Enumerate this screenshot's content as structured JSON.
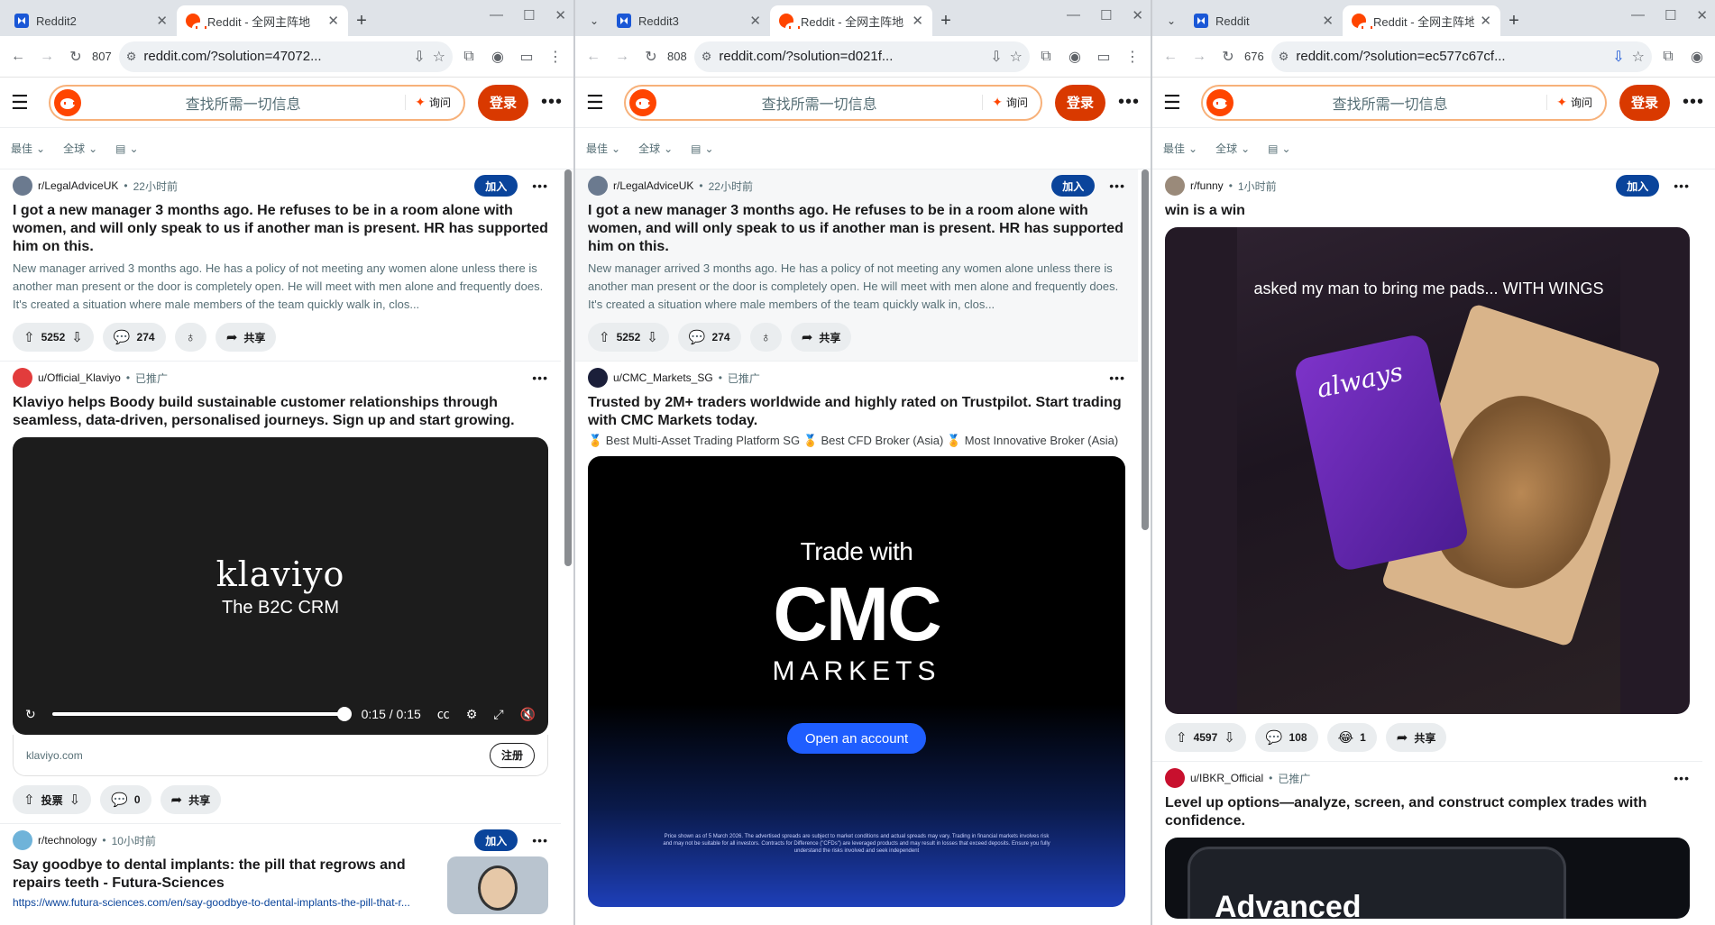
{
  "windows": [
    {
      "tabs": [
        {
          "title": "Reddit2"
        },
        {
          "title": "Reddit - 全网主阵地"
        }
      ],
      "count": "807",
      "url": "reddit.com/?solution=47072...",
      "search_placeholder": "查找所需一切信息",
      "ask_label": "询问",
      "login_label": "登录",
      "sort": {
        "best": "最佳",
        "region": "全球"
      },
      "posts": [
        {
          "subreddit": "r/LegalAdviceUK",
          "time": "22小时前",
          "join": "加入",
          "title": "I got a new manager 3 months ago. He refuses to be in a room alone with women, and will only speak to us if another man is present. HR has supported him on this.",
          "body": "New manager arrived 3 months ago. He has a policy of not meeting any women alone unless there is another man present or the door is completely open. He will meet with men alone and frequently does. It's created a situation where male members of the team quickly walk in, clos...",
          "votes": "5252",
          "comments": "274",
          "share": "共享"
        },
        {
          "author": "u/Official_Klaviyo",
          "promoted": "已推广",
          "title": "Klaviyo helps Boody build sustainable customer relationships through seamless, data-driven, personalised journeys. Sign up and start growing.",
          "ad_brand": "klaviyo",
          "ad_tagline": "The B2C CRM",
          "video_time": "0:15 / 0:15",
          "domain": "klaviyo.com",
          "signup": "注册",
          "vote_label": "投票",
          "comments": "0",
          "share": "共享"
        },
        {
          "subreddit": "r/technology",
          "time": "10小时前",
          "join": "加入",
          "title": "Say goodbye to dental implants: the pill that regrows and repairs teeth - Futura-Sciences",
          "link": "https://www.futura-sciences.com/en/say-goodbye-to-dental-implants-the-pill-that-r..."
        }
      ]
    },
    {
      "tabs": [
        {
          "title": "Reddit3"
        },
        {
          "title": "Reddit - 全网主阵地"
        }
      ],
      "count": "808",
      "url": "reddit.com/?solution=d021f...",
      "search_placeholder": "查找所需一切信息",
      "ask_label": "询问",
      "login_label": "登录",
      "sort": {
        "best": "最佳",
        "region": "全球"
      },
      "posts": [
        {
          "subreddit": "r/LegalAdviceUK",
          "time": "22小时前",
          "join": "加入",
          "title": "I got a new manager 3 months ago. He refuses to be in a room alone with women, and will only speak to us if another man is present. HR has supported him on this.",
          "body": "New manager arrived 3 months ago. He has a policy of not meeting any women alone unless there is another man present or the door is completely open. He will meet with men alone and frequently does. It's created a situation where male members of the team quickly walk in, clos...",
          "votes": "5252",
          "comments": "274",
          "share": "共享"
        },
        {
          "author": "u/CMC_Markets_SG",
          "promoted": "已推广",
          "title": "Trusted by 2M+ traders worldwide and highly rated on Trustpilot. Start trading with CMC Markets today.",
          "subtext": "🏅 Best Multi-Asset Trading Platform SG 🏅 Best CFD Broker (Asia) 🏅 Most Innovative Broker (Asia)",
          "ad_top": "Trade with",
          "ad_logo": "CMC",
          "ad_markets": "MARKETS",
          "ad_cta": "Open an account",
          "ad_fine": "Price shown as of 5 March 2026. The advertised spreads are subject to market conditions and actual spreads may vary. Trading in financial markets involves risk and may not be suitable for all investors. Contracts for Difference (\"CFDs\") are leveraged products and may result in losses that exceed deposits. Ensure you fully understand the risks involved and seek independent"
        }
      ]
    },
    {
      "tabs": [
        {
          "title": "Reddit"
        },
        {
          "title": "Reddit - 全网主阵地"
        }
      ],
      "count": "676",
      "url": "reddit.com/?solution=ec577c67cf...",
      "search_placeholder": "查找所需一切信息",
      "ask_label": "询问",
      "login_label": "登录",
      "sort": {
        "best": "最佳",
        "region": "全球"
      },
      "posts": [
        {
          "subreddit": "r/funny",
          "time": "1小时前",
          "join": "加入",
          "title": "win is a win",
          "caption": "asked my man to bring me pads... WITH WINGS",
          "pad_brand": "always",
          "votes": "4597",
          "comments": "108",
          "awards": "1",
          "share": "共享"
        },
        {
          "author": "u/IBKR_Official",
          "promoted": "已推广",
          "title": "Level up options—analyze, screen, and construct complex trades with confidence.",
          "ad_text": "Advanced"
        }
      ]
    }
  ],
  "colors": {
    "reddit_orange": "#ff4500",
    "login": "#d93900",
    "join": "#0a449b"
  }
}
